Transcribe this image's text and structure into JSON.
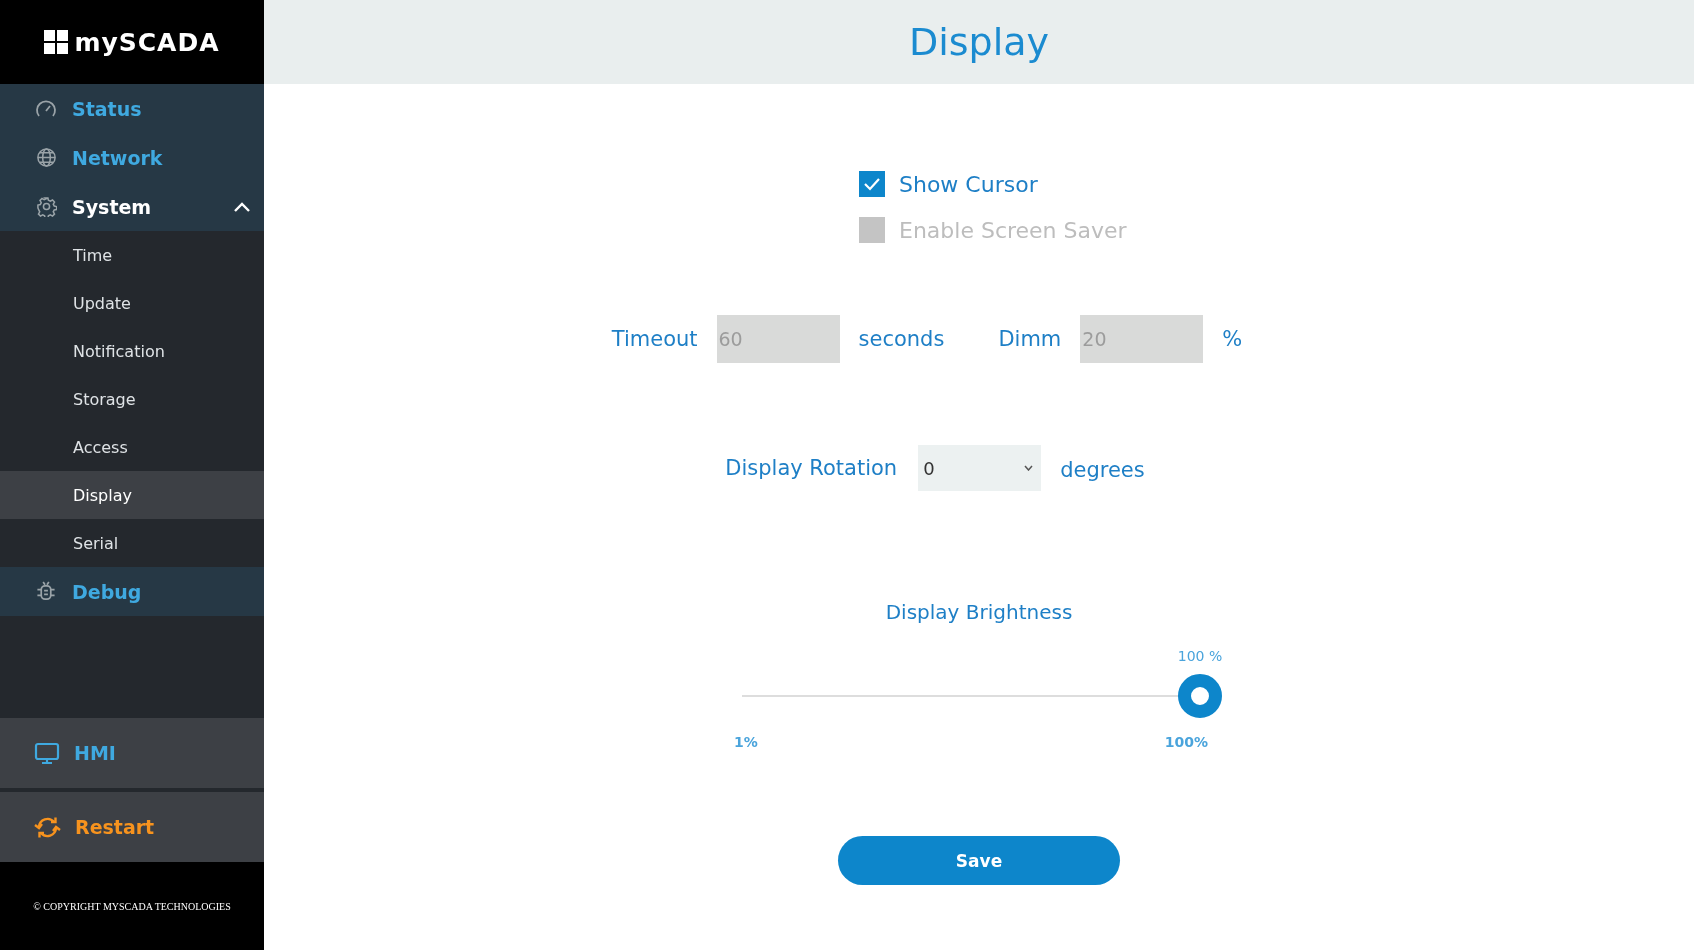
{
  "sidebar": {
    "logo": "mySCADA",
    "nav": [
      {
        "label": "Status",
        "selected": false,
        "expanded": false
      },
      {
        "label": "Network",
        "selected": false,
        "expanded": false
      },
      {
        "label": "System",
        "selected": true,
        "expanded": true,
        "children": [
          {
            "label": "Time",
            "selected": false
          },
          {
            "label": "Update",
            "selected": false
          },
          {
            "label": "Notification",
            "selected": false
          },
          {
            "label": "Storage",
            "selected": false
          },
          {
            "label": "Access",
            "selected": false
          },
          {
            "label": "Display",
            "selected": true
          },
          {
            "label": "Serial",
            "selected": false
          }
        ]
      },
      {
        "label": "Debug",
        "selected": false,
        "expanded": false
      }
    ],
    "actions": [
      {
        "label": "HMI",
        "kind": "hmi"
      },
      {
        "label": "Restart",
        "kind": "restart"
      }
    ],
    "footer": "© COPYRIGHT MYSCADA TECHNOLOGIES"
  },
  "page": {
    "title": "Display",
    "checkboxes": [
      {
        "label": "Show Cursor",
        "checked": true
      },
      {
        "label": "Enable Screen Saver",
        "checked": false
      }
    ],
    "screen_saver_fields": [
      {
        "label": "Timeout",
        "value": "60",
        "unit": "seconds",
        "disabled": true
      },
      {
        "label": "Dimm",
        "value": "20",
        "unit": "%",
        "disabled": true
      }
    ],
    "rotation": {
      "label": "Display Rotation",
      "value": "0",
      "unit": "degrees"
    },
    "brightness": {
      "title": "Display Brightness",
      "reading": "100 %",
      "level": 1,
      "min_label": "1%",
      "max_label": "100%"
    },
    "save_button": "Save"
  }
}
